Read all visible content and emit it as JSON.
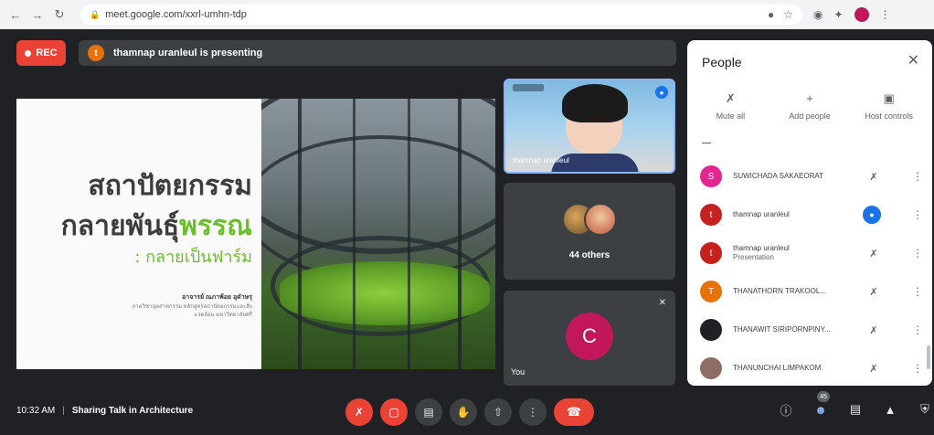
{
  "browser": {
    "url": "meet.google.com/xxrl-umhn-tdp",
    "profile_initial": ""
  },
  "meet": {
    "rec_label": "REC",
    "presenting_text": "thamnap uranleul is presenting",
    "presenter_initial": "t"
  },
  "slide": {
    "title_line1": "สถาปัตยกรรม",
    "title_line2_a": "กลายพันธุ์",
    "title_line2_b": "พรรณ",
    "title_line3": ": กลายเป็นฟาร์ม",
    "author": "อาจารย์ ณภาพ้อย อุดำษรุ",
    "author_sub": "ภาควิชาอุตสาหกรรม หลักสูตรสถาปัตยกรรมและสิ่งแวดล้อม มหาวิทยาลัยศรี"
  },
  "tiles": {
    "cam_name": "thamnap uranleul",
    "others_label": "44 others",
    "you_initial": "C",
    "you_label": "You"
  },
  "panel": {
    "title": "People",
    "actions": [
      "Mute all",
      "Add people",
      "Host controls"
    ],
    "people": [
      {
        "initial": "S",
        "color": "#e52592",
        "name": "SUWICHADA SAKAEORAT",
        "sub": "",
        "mic": "off"
      },
      {
        "initial": "t",
        "color": "#c5221f",
        "name": "thamnap uranleul",
        "sub": "",
        "mic": "active"
      },
      {
        "initial": "t",
        "color": "#c5221f",
        "name": "thamnap uranleul",
        "sub": "Presentation",
        "mic": "off"
      },
      {
        "initial": "T",
        "color": "#e8710a",
        "name": "THANATHORN TRAKOOL...",
        "sub": "",
        "mic": "off"
      },
      {
        "initial": "",
        "color": "#202124",
        "name": "THANAWIT SIRIPORNPINY...",
        "sub": "",
        "mic": "off"
      },
      {
        "initial": "",
        "color": "#8d6e63",
        "name": "THANUNCHAI LIMPAKOM",
        "sub": "",
        "mic": "off"
      }
    ]
  },
  "bottom": {
    "time": "10:32 AM",
    "meeting_name": "Sharing Talk in Architecture",
    "participant_count": "45"
  }
}
